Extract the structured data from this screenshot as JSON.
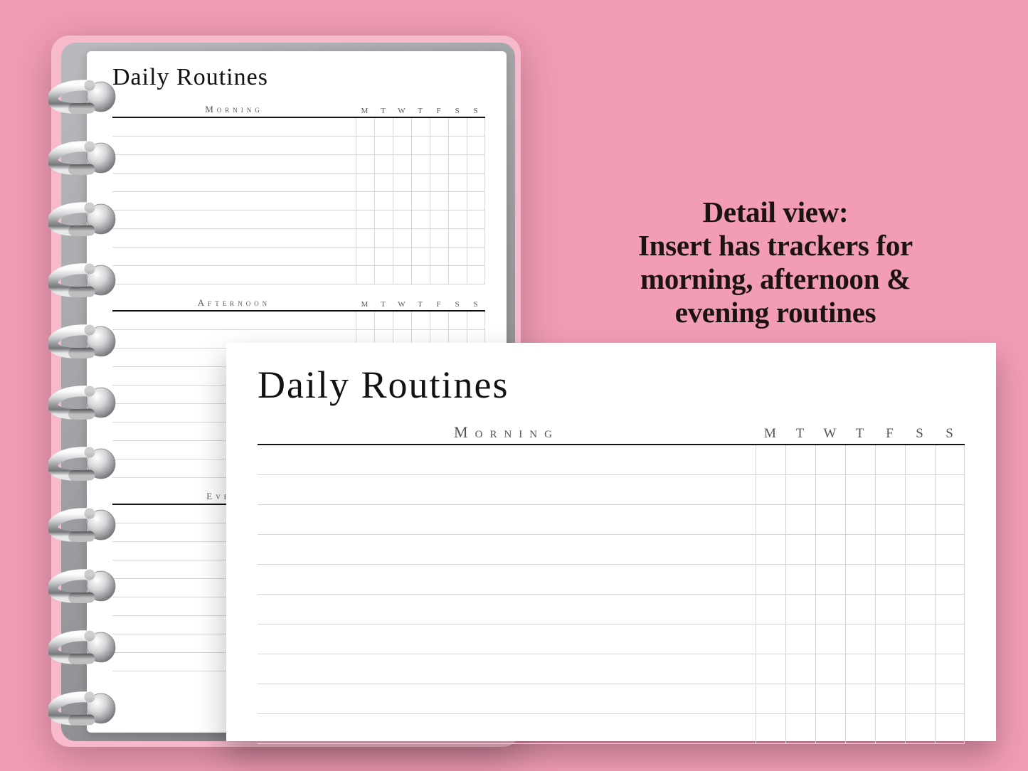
{
  "caption": {
    "line1": "Detail view:",
    "line2": "Insert has trackers for",
    "line3": "morning, afternoon &",
    "line4": "evening routines"
  },
  "planner": {
    "title": "Daily Routines",
    "days": [
      "M",
      "T",
      "W",
      "T",
      "F",
      "S",
      "S"
    ],
    "sections": [
      {
        "label": "Morning",
        "rows": 9
      },
      {
        "label": "Afternoon",
        "rows": 9
      },
      {
        "label": "Evening",
        "rows": 9
      }
    ]
  },
  "detail": {
    "title": "Daily Routines",
    "section_label": "Morning",
    "days": [
      "M",
      "T",
      "W",
      "T",
      "F",
      "S",
      "S"
    ],
    "rows": 10
  }
}
